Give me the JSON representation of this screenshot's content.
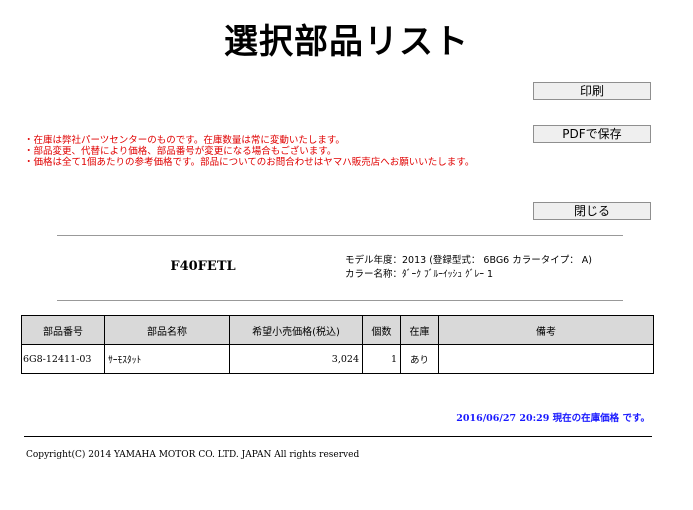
{
  "page": {
    "title": "選択部品リスト"
  },
  "buttons": {
    "print": "印刷",
    "pdf": "PDFで保存",
    "close": "閉じる"
  },
  "notes": [
    "・在庫は弊社パーツセンターのものです。在庫数量は常に変動いたします。",
    "・部品変更、代替により価格、部品番号が変更になる場合もございます。",
    "・価格は全て1個あたりの参考価格です。部品についてのお問合わせはヤマハ販売店へお願いいたします。"
  ],
  "model": {
    "name": "F40FETL",
    "year_line": "モデル年度：2013 (登録型式： 6BG6 カラータイプ： A)",
    "color_line": "カラー名称：ﾀﾞｰｸ ﾌﾞﾙｰｲｯｼｭ ｸﾞﾚｰ 1"
  },
  "table": {
    "headers": [
      "部品番号",
      "部品名称",
      "希望小売価格(税込)",
      "個数",
      "在庫",
      "備考"
    ],
    "rows": [
      {
        "part_number": "6G8-12411-03",
        "part_name": "ｻｰﾓｽﾀｯﾄ",
        "price": "3,024",
        "qty": "1",
        "stock": "あり",
        "remarks": ""
      }
    ]
  },
  "stock_note": {
    "datetime": "2016/06/27 20:29",
    "text": "現在の在庫価格 です。"
  },
  "footer": {
    "copyright": "Copyright(C) 2014 YAMAHA MOTOR CO. LTD. JAPAN All rights reserved"
  },
  "colors": {
    "note_red": "#e00000",
    "stock_blue": "#1a1aff",
    "header_gray": "#d9d9d9"
  }
}
